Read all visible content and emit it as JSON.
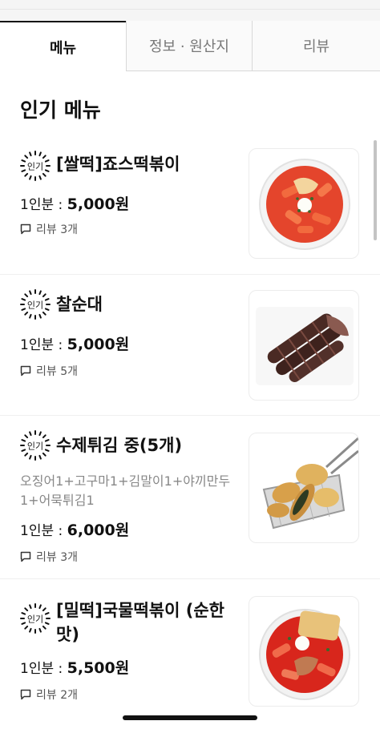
{
  "tabs": [
    {
      "label": "메뉴",
      "active": true
    },
    {
      "label": "정보 · 원산지",
      "active": false
    },
    {
      "label": "리뷰",
      "active": false
    }
  ],
  "section_title": "인기 메뉴",
  "badge_label": "인기",
  "price_prefix": "1인분 :",
  "items": [
    {
      "name": "[쌀떡]죠스떡볶이",
      "description": "",
      "price": "5,000원",
      "reviews": "리뷰 3개",
      "image": "tteokbokki-bowl"
    },
    {
      "name": "찰순대",
      "description": "",
      "price": "5,000원",
      "reviews": "리뷰 5개",
      "image": "sundae-plate"
    },
    {
      "name": "수제튀김 중(5개)",
      "description": "오징어1+고구마1+김말이1+야끼만두1+어묵튀김1",
      "price": "6,000원",
      "reviews": "리뷰 3개",
      "image": "fried-basket"
    },
    {
      "name": "[밀떡]국물떡볶이 (순한맛)",
      "description": "",
      "price": "5,500원",
      "reviews": "리뷰 2개",
      "image": "soup-tteokbokki-bowl"
    }
  ],
  "colors": {
    "accent": "#111111",
    "muted": "#888888",
    "divider": "#efefef"
  }
}
